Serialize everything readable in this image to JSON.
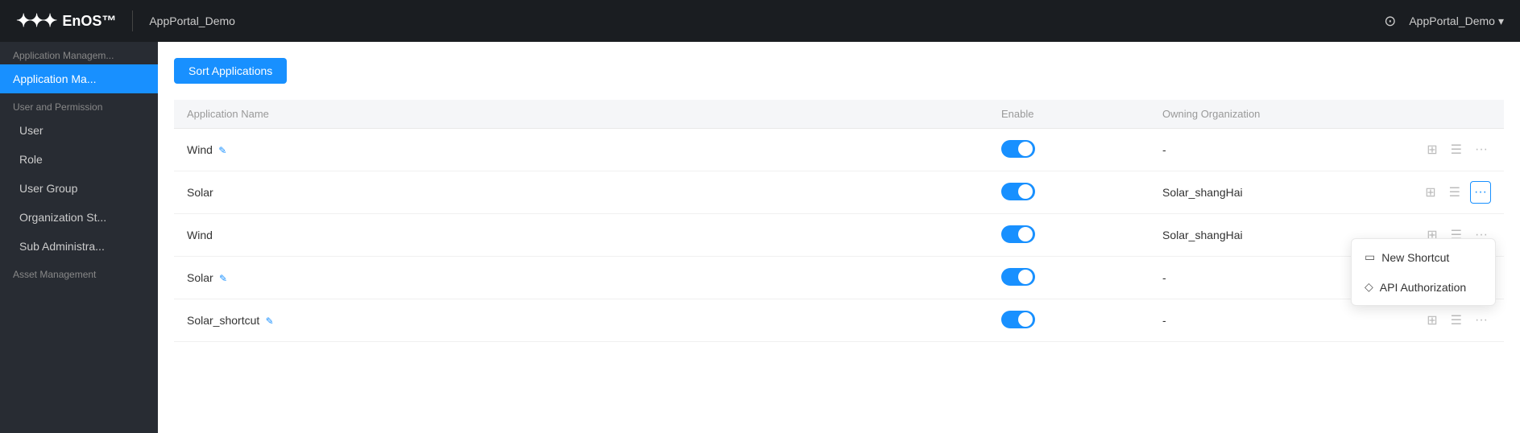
{
  "topnav": {
    "logo_text": "EnOS™",
    "app_name": "AppPortal_Demo",
    "help_icon": "?",
    "user_label": "AppPortal_Demo",
    "dropdown_icon": "▾"
  },
  "sidebar": {
    "section1_label": "Application Managem...",
    "item1_label": "Application Ma...",
    "section2_label": "User and Permission",
    "sub_items": [
      {
        "label": "User"
      },
      {
        "label": "Role"
      },
      {
        "label": "User Group"
      },
      {
        "label": "Organization St..."
      },
      {
        "label": "Sub Administra..."
      }
    ],
    "section3_label": "Asset Management"
  },
  "toolbar": {
    "sort_btn_label": "Sort Applications"
  },
  "table": {
    "headers": [
      "Application Name",
      "Enable",
      "Owning Organization"
    ],
    "rows": [
      {
        "name": "Wind",
        "has_edit": true,
        "enabled": true,
        "org": "-"
      },
      {
        "name": "Solar",
        "has_edit": false,
        "enabled": true,
        "org": "Solar_shangHai"
      },
      {
        "name": "Wind",
        "has_edit": false,
        "enabled": true,
        "org": "Solar_shangHai"
      },
      {
        "name": "Solar",
        "has_edit": true,
        "enabled": true,
        "org": "-"
      },
      {
        "name": "Solar_shortcut",
        "has_edit": true,
        "enabled": true,
        "org": "-"
      }
    ],
    "action_icons": [
      "grid-icon",
      "list-icon",
      "more-icon"
    ]
  },
  "dropdown_menu": {
    "items": [
      {
        "icon": "new-shortcut-icon",
        "label": "New Shortcut"
      },
      {
        "icon": "api-auth-icon",
        "label": "API Authorization"
      }
    ]
  }
}
